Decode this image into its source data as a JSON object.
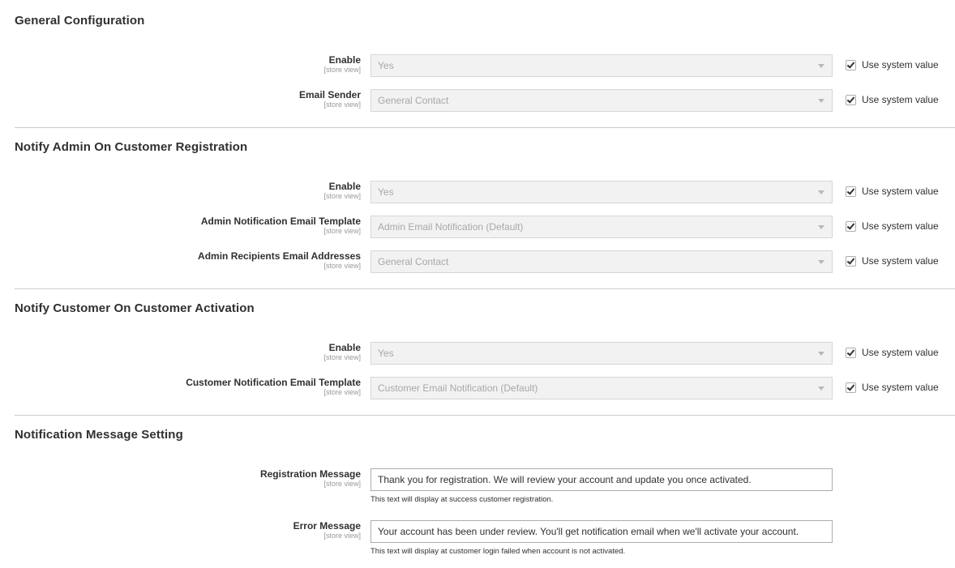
{
  "sections": [
    {
      "title": "General Configuration",
      "fields": [
        {
          "label": "Enable",
          "scope": "[store view]",
          "value": "Yes",
          "use_system_value": "Use system value"
        },
        {
          "label": "Email Sender",
          "scope": "[store view]",
          "value": "General Contact",
          "use_system_value": "Use system value"
        }
      ]
    },
    {
      "title": "Notify Admin On Customer Registration",
      "fields": [
        {
          "label": "Enable",
          "scope": "[store view]",
          "value": "Yes",
          "use_system_value": "Use system value"
        },
        {
          "label": "Admin Notification Email Template",
          "scope": "[store view]",
          "value": "Admin Email Notification (Default)",
          "use_system_value": "Use system value"
        },
        {
          "label": "Admin Recipients Email Addresses",
          "scope": "[store view]",
          "value": "General Contact",
          "use_system_value": "Use system value"
        }
      ]
    },
    {
      "title": "Notify Customer On Customer Activation",
      "fields": [
        {
          "label": "Enable",
          "scope": "[store view]",
          "value": "Yes",
          "use_system_value": "Use system value"
        },
        {
          "label": "Customer Notification Email Template",
          "scope": "[store view]",
          "value": "Customer Email Notification (Default)",
          "use_system_value": "Use system value"
        }
      ]
    },
    {
      "title": "Notification Message Setting",
      "fields": [
        {
          "label": "Registration Message",
          "scope": "[store view]",
          "value": "Thank you for registration. We will review your account and update you once activated.",
          "note": "This text will display at success customer registration."
        },
        {
          "label": "Error Message",
          "scope": "[store view]",
          "value": "Your account has been under review. You'll get notification email when we'll activate your account.",
          "note": "This text will display at customer login failed when account is not activated."
        }
      ]
    }
  ]
}
